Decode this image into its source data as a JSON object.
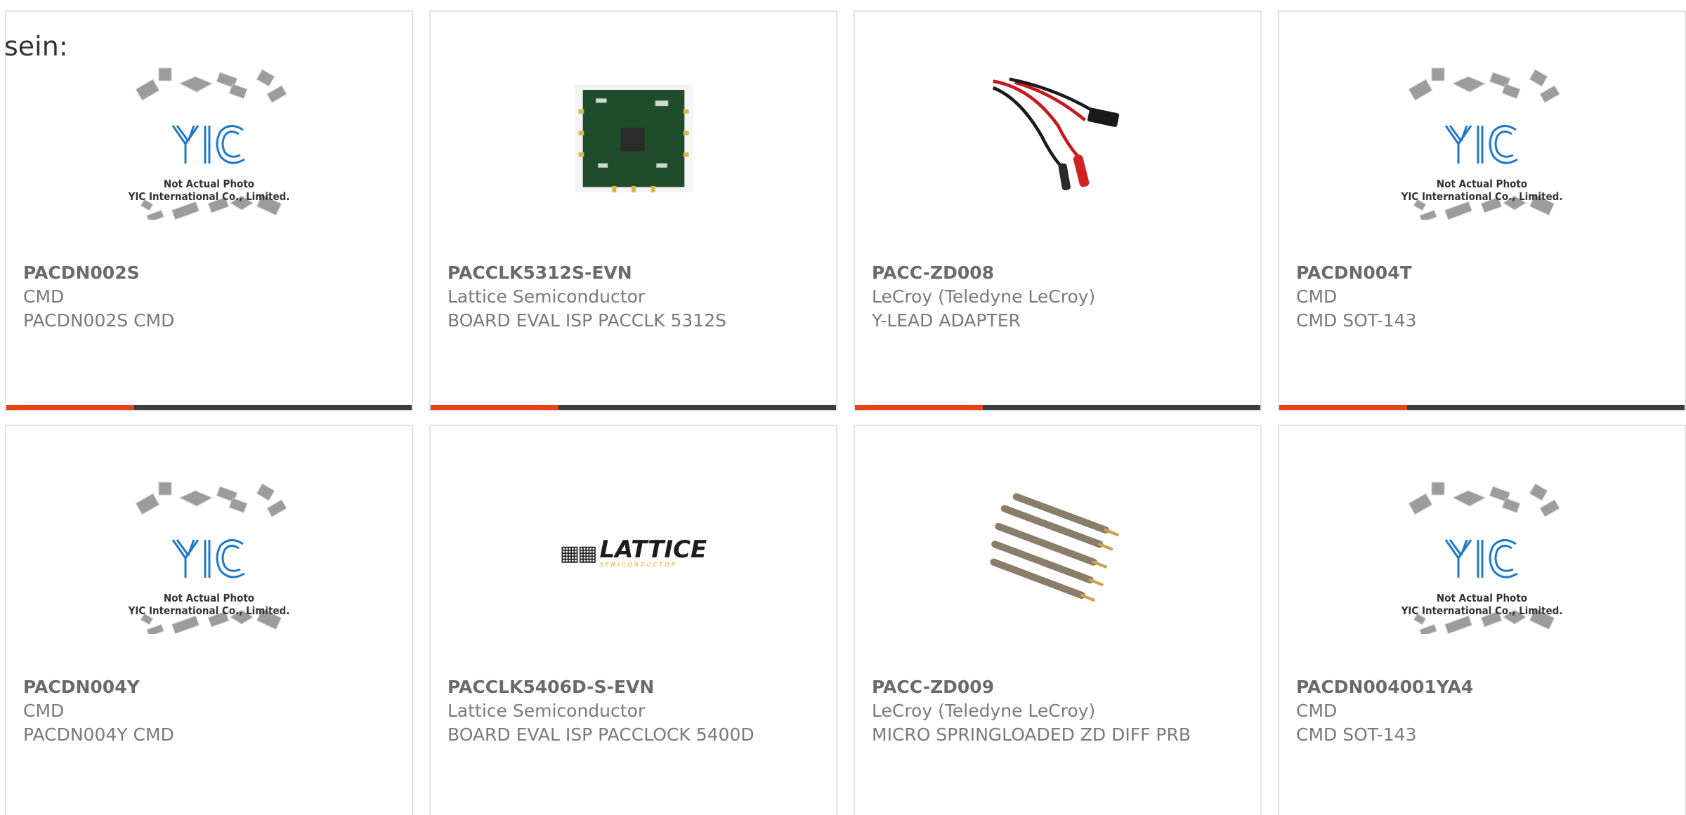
{
  "fragment_text": "sein:",
  "colors": {
    "accent": "#e8421a",
    "bar": "#3d3d3d",
    "border": "#e2e2e2",
    "text": "#7a7a7a"
  },
  "placeholder": {
    "line1": "Not Actual Photo",
    "line2": "YIC International Co., Limited.",
    "logo": "YIC"
  },
  "products": [
    {
      "part": "PACDN002S",
      "manufacturer": "CMD",
      "description": "PACDN002S CMD",
      "image": "yic-placeholder-icon"
    },
    {
      "part": "PACCLK5312S-EVN",
      "manufacturer": "Lattice Semiconductor",
      "description": "BOARD EVAL ISP PACCLK 5312S",
      "image": "eval-board-icon"
    },
    {
      "part": "PACC-ZD008",
      "manufacturer": "LeCroy (Teledyne LeCroy)",
      "description": "Y-LEAD ADAPTER",
      "image": "cable-adapter-icon"
    },
    {
      "part": "PACDN004T",
      "manufacturer": "CMD",
      "description": "CMD SOT-143",
      "image": "yic-placeholder-icon"
    },
    {
      "part": "PACDN004Y",
      "manufacturer": "CMD",
      "description": "PACDN004Y CMD",
      "image": "yic-placeholder-icon"
    },
    {
      "part": "PACCLK5406D-S-EVN",
      "manufacturer": "Lattice Semiconductor",
      "description": "BOARD EVAL ISP PACCLOCK 5400D",
      "image": "lattice-logo-icon"
    },
    {
      "part": "PACC-ZD009",
      "manufacturer": "LeCroy (Teledyne LeCroy)",
      "description": "MICRO SPRINGLOADED ZD DIFF PRB",
      "image": "spring-pins-icon"
    },
    {
      "part": "PACDN004001YA4",
      "manufacturer": "CMD",
      "description": "CMD SOT-143",
      "image": "yic-placeholder-icon"
    }
  ],
  "lattice_logo": {
    "name": "LATTICE",
    "sub": "SEMICONDUCTOR"
  }
}
